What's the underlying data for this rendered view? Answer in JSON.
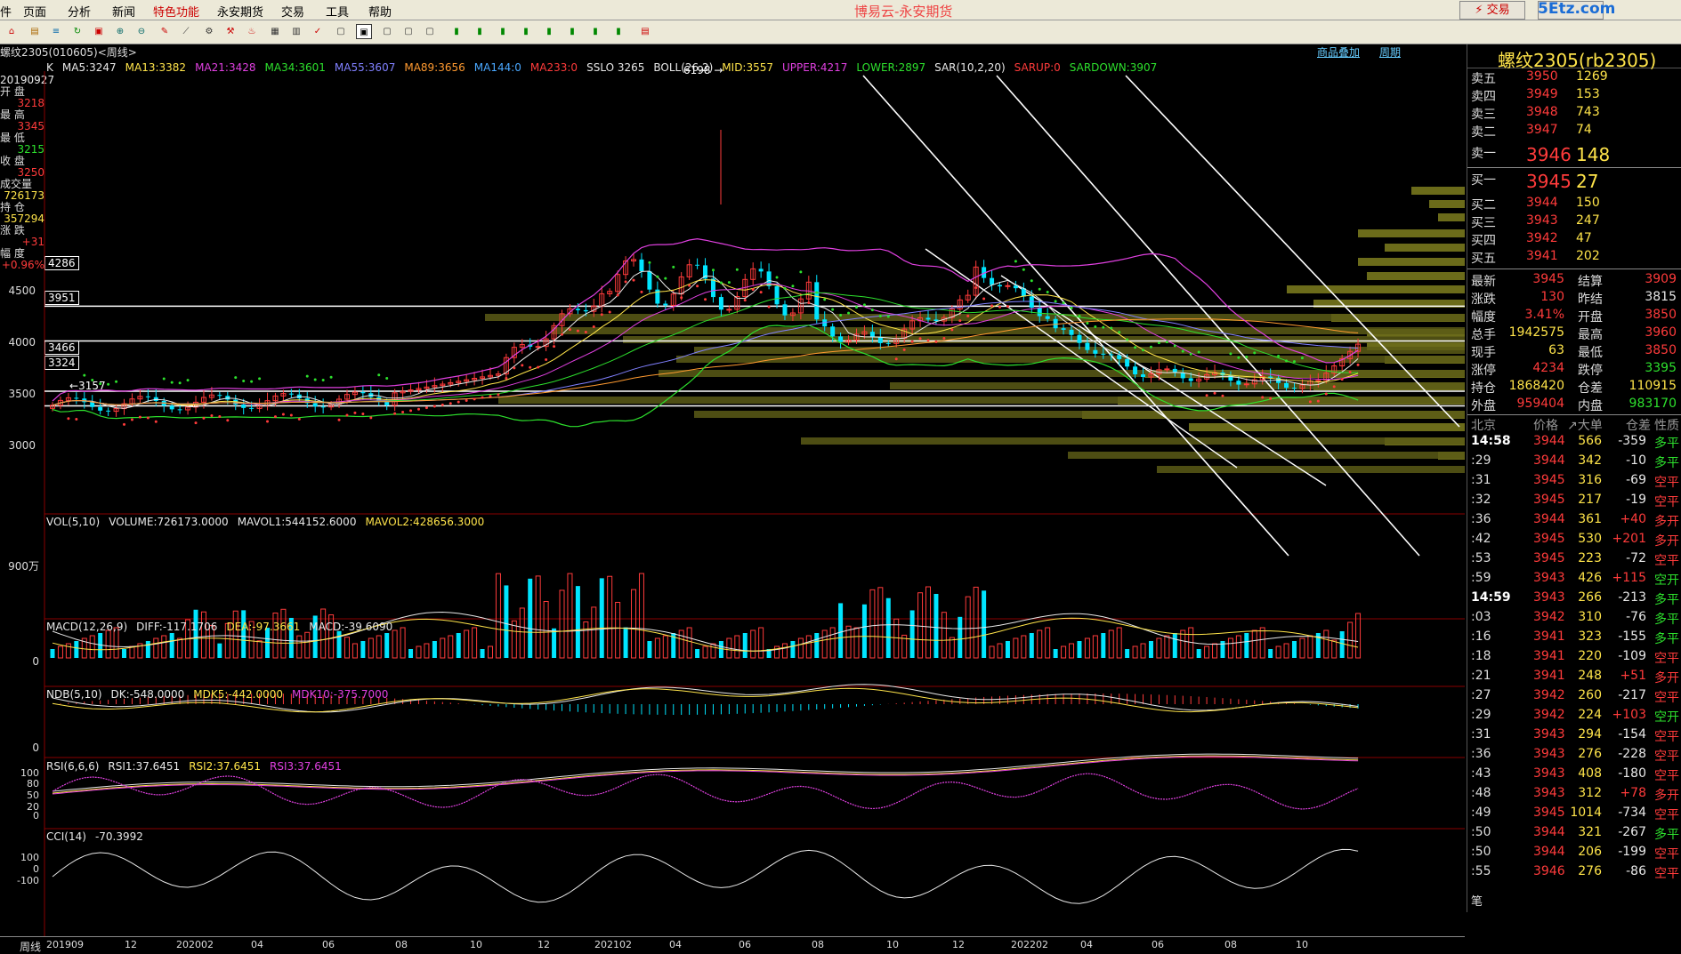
{
  "menu": {
    "items": [
      "页面",
      "分析",
      "新闻",
      "特色功能",
      "永安期货",
      "交易",
      "工具",
      "帮助"
    ],
    "partial_first": "件",
    "app_title": "博易云-永安期货",
    "trade_btn": "⚡ 交易",
    "watermark": "5Etz.com"
  },
  "chart_title": "螺纹2305(010605)<周线>",
  "top_links": [
    "商品叠加",
    "周期"
  ],
  "main_indicator_line": {
    "label": "K",
    "items": [
      {
        "text": "MA5:3247",
        "color": "#e8e8e8"
      },
      {
        "text": "MA13:3382",
        "color": "#ffe44a"
      },
      {
        "text": "MA21:3428",
        "color": "#e040e0"
      },
      {
        "text": "MA34:3601",
        "color": "#2de02d"
      },
      {
        "text": "MA55:3607",
        "color": "#8080ff"
      },
      {
        "text": "MA89:3656",
        "color": "#ff9a30"
      },
      {
        "text": "MA144:0",
        "color": "#4aa8ff"
      },
      {
        "text": "MA233:0",
        "color": "#ff3b3b"
      },
      {
        "text": "SSLO 3265",
        "color": "#e8e8e8"
      },
      {
        "text": "BOLL(26,2)",
        "color": "#e8e8e8"
      },
      {
        "text": "MID:3557",
        "color": "#ffe44a"
      },
      {
        "text": "UPPER:4217",
        "color": "#e040e0"
      },
      {
        "text": "LOWER:2897",
        "color": "#2de02d"
      },
      {
        "text": "SAR(10,2,20)",
        "color": "#e8e8e8"
      },
      {
        "text": "SARUP:0",
        "color": "#ff3b3b"
      },
      {
        "text": "SARDOWN:3907",
        "color": "#2de02d"
      }
    ]
  },
  "left_info": [
    {
      "label": "",
      "value": "20190927"
    },
    {
      "label": "开 盘",
      "value": "3218"
    },
    {
      "label": "最 高",
      "value": "3345"
    },
    {
      "label": "最 低",
      "value": "3215"
    },
    {
      "label": "收 盘",
      "value": "3250"
    },
    {
      "label": "成交量",
      "value": "726173"
    },
    {
      "label": "持 仓",
      "value": "357294"
    },
    {
      "label": "涨 跌",
      "value": "+31"
    },
    {
      "label": "幅 度",
      "value": "+0.96%"
    }
  ],
  "price_axis": {
    "ticks": [
      "4500",
      "4000",
      "3500",
      "3000"
    ],
    "boxed": [
      "4286",
      "3951",
      "3466",
      "3324"
    ],
    "max_label": "6198",
    "min_label": "3157"
  },
  "vol_indicator": {
    "line": [
      {
        "text": "VOL(5,10)",
        "color": "#e8e8e8"
      },
      {
        "text": "VOLUME:726173.0000",
        "color": "#e8e8e8"
      },
      {
        "text": "MAVOL1:544152.6000",
        "color": "#e8e8e8"
      },
      {
        "text": "MAVOL2:428656.3000",
        "color": "#ffe44a"
      }
    ],
    "tick": "900万"
  },
  "macd_indicator": {
    "line": [
      {
        "text": "MACD(12,26,9)",
        "color": "#e8e8e8"
      },
      {
        "text": "DIFF:-117.1706",
        "color": "#e8e8e8"
      },
      {
        "text": "DEA:-97.3661",
        "color": "#ffe44a"
      },
      {
        "text": "MACD:-39.6090",
        "color": "#e8e8e8"
      }
    ],
    "tick": "0"
  },
  "ndb_indicator": {
    "line": [
      {
        "text": "NDB(5,10)",
        "color": "#e8e8e8"
      },
      {
        "text": "DK:-548.0000",
        "color": "#e8e8e8"
      },
      {
        "text": "MDK5:-442.0000",
        "color": "#ffe44a"
      },
      {
        "text": "MDK10:-375.7000",
        "color": "#e040e0"
      }
    ],
    "tick": "0"
  },
  "rsi_indicator": {
    "line": [
      {
        "text": "RSI(6,6,6)",
        "color": "#e8e8e8"
      },
      {
        "text": "RSI1:37.6451",
        "color": "#e8e8e8"
      },
      {
        "text": "RSI2:37.6451",
        "color": "#ffe44a"
      },
      {
        "text": "RSI3:37.6451",
        "color": "#e040e0"
      }
    ],
    "ticks": [
      "100",
      "80",
      "50",
      "20",
      "0"
    ]
  },
  "cci_indicator": {
    "line": [
      {
        "text": "CCI(14)",
        "color": "#e8e8e8"
      },
      {
        "text": "-70.3992",
        "color": "#e8e8e8"
      }
    ],
    "ticks": [
      "100",
      "0",
      "-100"
    ]
  },
  "x_axis": {
    "label": "周线",
    "ticks": [
      "201909",
      "12",
      "202002",
      "04",
      "06",
      "08",
      "10",
      "12",
      "202102",
      "04",
      "06",
      "08",
      "10",
      "12",
      "202202",
      "04",
      "06",
      "08",
      "10"
    ]
  },
  "quote": {
    "title": "螺纹2305(rb2305)",
    "asks": [
      {
        "label": "卖五",
        "price": "3950",
        "vol": "1269"
      },
      {
        "label": "卖四",
        "price": "3949",
        "vol": "153"
      },
      {
        "label": "卖三",
        "price": "3948",
        "vol": "743"
      },
      {
        "label": "卖二",
        "price": "3947",
        "vol": "74"
      },
      {
        "label": "卖一",
        "price": "3946",
        "vol": "148"
      }
    ],
    "bids": [
      {
        "label": "买一",
        "price": "3945",
        "vol": "27"
      },
      {
        "label": "买二",
        "price": "3944",
        "vol": "150"
      },
      {
        "label": "买三",
        "price": "3943",
        "vol": "247"
      },
      {
        "label": "买四",
        "price": "3942",
        "vol": "47"
      },
      {
        "label": "买五",
        "price": "3941",
        "vol": "202"
      }
    ],
    "stats": [
      {
        "l1": "最新",
        "v1": "3945",
        "c1": "red",
        "l2": "结算",
        "v2": "3909",
        "c2": "red"
      },
      {
        "l1": "涨跌",
        "v1": "130",
        "c1": "red",
        "l2": "昨结",
        "v2": "3815",
        "c2": "wht"
      },
      {
        "l1": "幅度",
        "v1": "3.41%",
        "c1": "red",
        "l2": "开盘",
        "v2": "3850",
        "c2": "red"
      },
      {
        "l1": "总手",
        "v1": "1942575",
        "c1": "yel",
        "l2": "最高",
        "v2": "3960",
        "c2": "red"
      },
      {
        "l1": "现手",
        "v1": "63",
        "c1": "yel",
        "l2": "最低",
        "v2": "3850",
        "c2": "red"
      },
      {
        "l1": "涨停",
        "v1": "4234",
        "c1": "red",
        "l2": "跌停",
        "v2": "3395",
        "c2": "grn"
      },
      {
        "l1": "持仓",
        "v1": "1868420",
        "c1": "yel",
        "l2": "仓差",
        "v2": "110915",
        "c2": "yel"
      },
      {
        "l1": "外盘",
        "v1": "959404",
        "c1": "red",
        "l2": "内盘",
        "v2": "983170",
        "c2": "grn"
      }
    ],
    "tick_header": [
      "北京",
      "价格",
      "↗大单",
      "仓差",
      "性质"
    ],
    "ticks": [
      {
        "t": "14:58",
        "p": "3944",
        "v": "566",
        "d": "-359",
        "n": "多平",
        "nc": "grn"
      },
      {
        "t": ":29",
        "p": "3944",
        "v": "342",
        "d": "-10",
        "n": "多平",
        "nc": "grn"
      },
      {
        "t": ":31",
        "p": "3945",
        "v": "316",
        "d": "-69",
        "n": "空平",
        "nc": "red"
      },
      {
        "t": ":32",
        "p": "3945",
        "v": "217",
        "d": "-19",
        "n": "空平",
        "nc": "red"
      },
      {
        "t": ":36",
        "p": "3944",
        "v": "361",
        "d": "+40",
        "n": "多开",
        "nc": "red"
      },
      {
        "t": ":42",
        "p": "3945",
        "v": "530",
        "d": "+201",
        "n": "多开",
        "nc": "red"
      },
      {
        "t": ":53",
        "p": "3945",
        "v": "223",
        "d": "-72",
        "n": "空平",
        "nc": "red"
      },
      {
        "t": ":59",
        "p": "3943",
        "v": "426",
        "d": "+115",
        "n": "空开",
        "nc": "grn"
      },
      {
        "t": "14:59",
        "p": "3943",
        "v": "266",
        "d": "-213",
        "n": "多平",
        "nc": "grn"
      },
      {
        "t": ":03",
        "p": "3942",
        "v": "310",
        "d": "-76",
        "n": "多平",
        "nc": "grn"
      },
      {
        "t": ":16",
        "p": "3941",
        "v": "323",
        "d": "-155",
        "n": "多平",
        "nc": "grn"
      },
      {
        "t": ":18",
        "p": "3941",
        "v": "220",
        "d": "-109",
        "n": "空平",
        "nc": "red"
      },
      {
        "t": ":21",
        "p": "3941",
        "v": "248",
        "d": "+51",
        "n": "多开",
        "nc": "red"
      },
      {
        "t": ":27",
        "p": "3942",
        "v": "260",
        "d": "-217",
        "n": "空平",
        "nc": "red"
      },
      {
        "t": ":29",
        "p": "3942",
        "v": "224",
        "d": "+103",
        "n": "空开",
        "nc": "grn"
      },
      {
        "t": ":31",
        "p": "3943",
        "v": "294",
        "d": "-154",
        "n": "空平",
        "nc": "red"
      },
      {
        "t": ":36",
        "p": "3943",
        "v": "276",
        "d": "-228",
        "n": "空平",
        "nc": "red"
      },
      {
        "t": ":43",
        "p": "3943",
        "v": "408",
        "d": "-180",
        "n": "空平",
        "nc": "red"
      },
      {
        "t": ":48",
        "p": "3943",
        "v": "312",
        "d": "+78",
        "n": "多开",
        "nc": "red"
      },
      {
        "t": ":49",
        "p": "3945",
        "v": "1014",
        "d": "-734",
        "n": "空平",
        "nc": "red"
      },
      {
        "t": ":50",
        "p": "3944",
        "v": "321",
        "d": "-267",
        "n": "多平",
        "nc": "grn"
      },
      {
        "t": ":50",
        "p": "3944",
        "v": "206",
        "d": "-199",
        "n": "空平",
        "nc": "red"
      },
      {
        "t": ":55",
        "p": "3946",
        "v": "276",
        "d": "-86",
        "n": "空平",
        "nc": "red"
      }
    ],
    "bottom_tab": "笔"
  },
  "colors": {
    "up": "#ff3b3b",
    "down": "#00e5ff",
    "boxline": "#ffffff",
    "volprofile": "#6b6b1a"
  }
}
